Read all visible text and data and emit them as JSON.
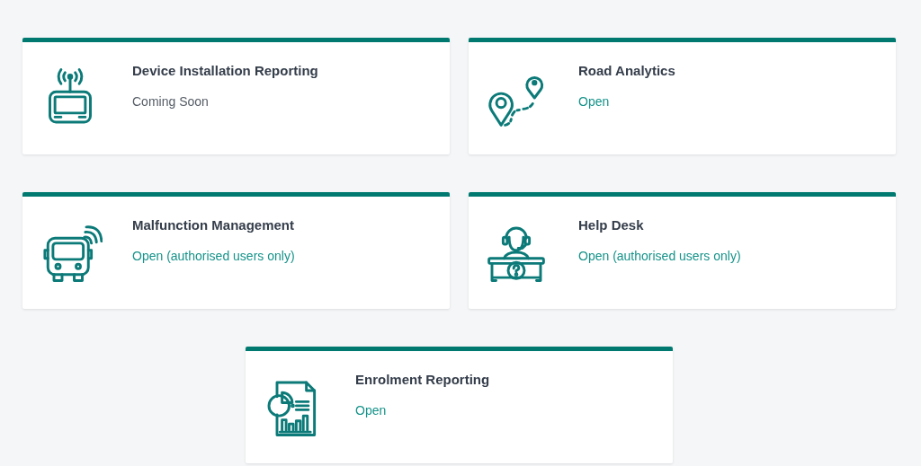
{
  "cards": [
    {
      "title": "Device Installation Reporting",
      "status": {
        "text": "Coming Soon",
        "kind": "disabled"
      }
    },
    {
      "title": "Road Analytics",
      "status": {
        "text": "Open",
        "kind": "link"
      }
    },
    {
      "title": "Malfunction Management",
      "status": {
        "text": "Open (authorised users only)",
        "kind": "link"
      }
    },
    {
      "title": "Help Desk",
      "status": {
        "text": "Open (authorised users only)",
        "kind": "link"
      }
    },
    {
      "title": "Enrolment Reporting",
      "status": {
        "text": "Open",
        "kind": "link"
      }
    }
  ]
}
